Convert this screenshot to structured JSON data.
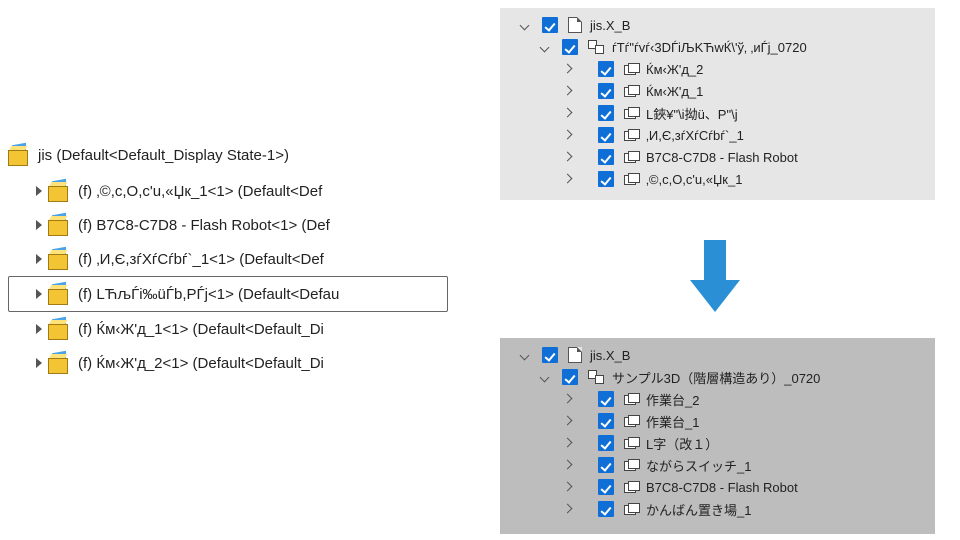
{
  "left": {
    "root_label": "jis  (Default<Default_Display State-1>)",
    "items": [
      {
        "label": "(f) ‚©,c,O,c'u,«Џк_1<1> (Default<Def"
      },
      {
        "label": "(f) B7C8-C7D8 - Flash Robot<1> (Def"
      },
      {
        "label": "(f) ‚И,Є,зѓХѓCѓbѓ`_1<1> (Default<Def"
      },
      {
        "label": "(f) LЋљЃi‰üЃb,РЃj<1> (Default<Defau",
        "selected": true
      },
      {
        "label": "(f) Ќм‹Ж'д_1<1> (Default<Default_Di"
      },
      {
        "label": "(f) Ќм‹Ж'д_2<1> (Default<Default_Di"
      }
    ]
  },
  "top_tree": {
    "root": "jis.X_B",
    "assembly": "ѓTѓ\"ѓvѓ‹3DЃiЉKЋwЌ\\'ў‚ ‚иЃj_0720",
    "parts": [
      "Ќм‹Ж'д_2",
      "Ќм‹Ж'д_1",
      "L鋏¥\"\\i拗ü、P\"\\j",
      "‚И,Є,зѓХѓCѓbѓ`_1",
      "B7C8-C7D8 - Flash Robot",
      "‚©,c,O,c'u,«Џк_1"
    ]
  },
  "bot_tree": {
    "root": "jis.X_B",
    "assembly": "サンプル3D（階層構造あり）_0720",
    "parts": [
      "作業台_2",
      "作業台_1",
      "L字（改１）",
      "ながらスイッチ_1",
      "B7C8-C7D8 - Flash Robot",
      "かんばん置き場_1"
    ]
  }
}
